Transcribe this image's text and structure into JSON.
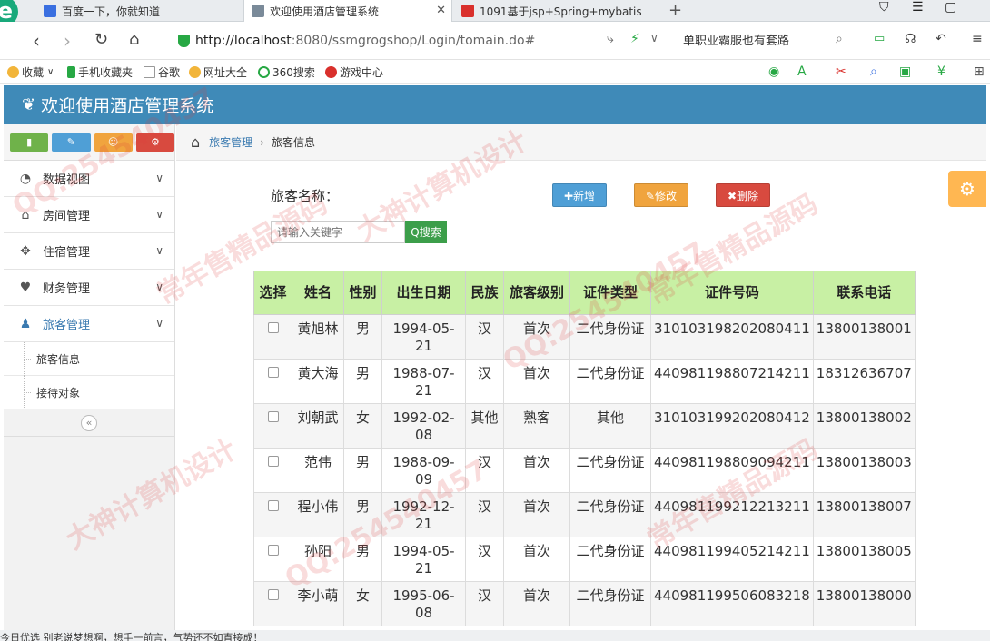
{
  "browser": {
    "tabs": [
      {
        "title": "百度一下，你就知道",
        "color": "#3a6fe0"
      },
      {
        "title": "欢迎使用酒店管理系统",
        "color": "#7a8a99"
      },
      {
        "title": "1091基于jsp+Spring+mybatis",
        "color": "#d9302c"
      }
    ],
    "url_host": "http://localhost",
    "url_path": ":8080/ssmgrogshop/Login/tomain.do#",
    "search_text": "单职业霸服也有套路",
    "bookmarks": [
      "收藏",
      "手机收藏夹",
      "谷歌",
      "网址大全",
      "360搜索",
      "游戏中心"
    ]
  },
  "app": {
    "title": "欢迎使用酒店管理系统",
    "header_color": "#3f8ab8"
  },
  "sidebar": {
    "shortcut_buttons": [
      {
        "icon": "signal-icon",
        "glyph": "▮",
        "color": "#6fb24a"
      },
      {
        "icon": "pencil-icon",
        "glyph": "✎",
        "color": "#4f9fd6"
      },
      {
        "icon": "users-icon",
        "glyph": "☺",
        "color": "#f0a43e"
      },
      {
        "icon": "cogs-icon",
        "glyph": "⚙",
        "color": "#d84a3f"
      }
    ],
    "menu": [
      {
        "label": "数据视图",
        "glyph": "◔"
      },
      {
        "label": "房间管理",
        "glyph": "⌂"
      },
      {
        "label": "住宿管理",
        "glyph": "✥"
      },
      {
        "label": "财务管理",
        "glyph": "♥"
      },
      {
        "label": "旅客管理",
        "glyph": "♟"
      }
    ],
    "submenu": [
      "旅客信息",
      "接待对象"
    ],
    "collapse_glyph": "«"
  },
  "breadcrumb": {
    "home_glyph": "⌂",
    "section": "旅客管理",
    "page": "旅客信息",
    "separator": "›"
  },
  "toolbar": {
    "name_label": "旅客名称：",
    "add_label": "✚新增",
    "edit_label": "✎修改",
    "delete_label": "✖删除",
    "search_placeholder": "请输入关键字",
    "search_label": "Q搜索"
  },
  "table": {
    "headers": [
      "选择",
      "姓名",
      "性别",
      "出生日期",
      "民族",
      "旅客级别",
      "证件类型",
      "证件号码",
      "联系电话"
    ],
    "rows": [
      [
        "",
        "黄旭林",
        "男",
        "1994-05-21",
        "汉",
        "首次",
        "二代身份证",
        "310103198202080411",
        "13800138001"
      ],
      [
        "",
        "黄大海",
        "男",
        "1988-07-21",
        "汉",
        "首次",
        "二代身份证",
        "440981198807214211",
        "18312636707"
      ],
      [
        "",
        "刘朝武",
        "女",
        "1992-02-08",
        "其他",
        "熟客",
        "其他",
        "310103199202080412",
        "13800138002"
      ],
      [
        "",
        "范伟",
        "男",
        "1988-09-09",
        "汉",
        "首次",
        "二代身份证",
        "440981198809094211",
        "13800138003"
      ],
      [
        "",
        "程小伟",
        "男",
        "1992-12-21",
        "汉",
        "首次",
        "二代身份证",
        "440981199212213211",
        "13800138007"
      ],
      [
        "",
        "孙阳",
        "男",
        "1994-05-21",
        "汉",
        "首次",
        "二代身份证",
        "440981199405214211",
        "13800138005"
      ],
      [
        "",
        "李小萌",
        "女",
        "1995-06-08",
        "汉",
        "首次",
        "二代身份证",
        "440981199506083218",
        "13800138000"
      ]
    ]
  },
  "watermarks": [
    "QQ:254540457",
    "常年售精品源码",
    "大神计算机设计",
    "QQ:254540457",
    "常年售精品源码",
    "大神计算机设计",
    "QQ:254540457",
    "常年售精品源码"
  ],
  "statusbar": "今日优选    别老说梦想啊，想手一前言，气势还不如直接成！"
}
